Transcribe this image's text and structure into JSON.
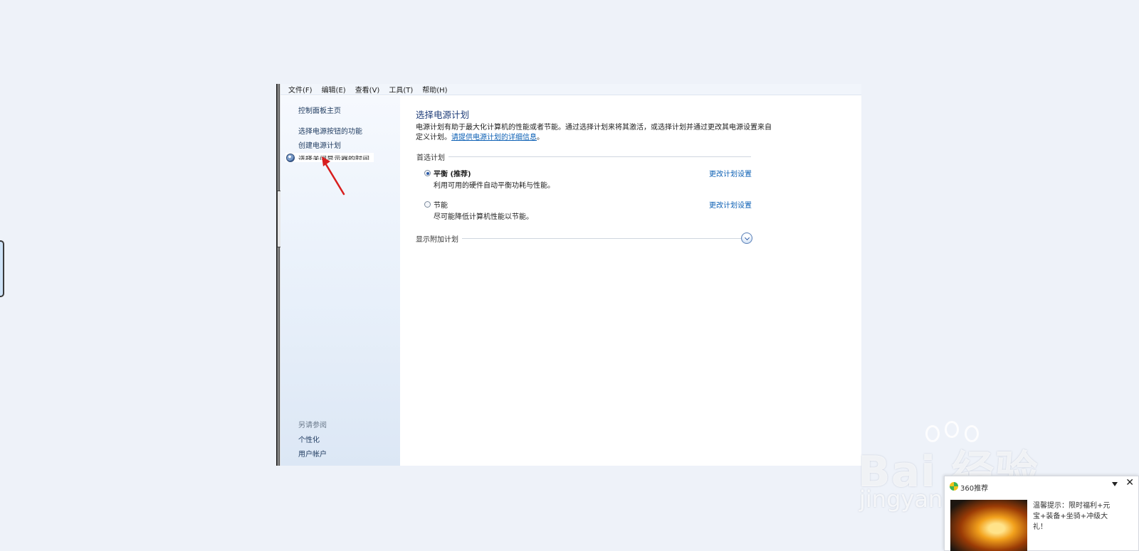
{
  "menubar": {
    "items": [
      "文件(F)",
      "编辑(E)",
      "查看(V)",
      "工具(T)",
      "帮助(H)"
    ]
  },
  "sidebar": {
    "home": "控制面板主页",
    "links": [
      "选择电源按钮的功能",
      "创建电源计划"
    ],
    "hovered_item": "选择关闭显示器的时间",
    "see_also_title": "另请参阅",
    "see_also": [
      "个性化",
      "用户帐户"
    ]
  },
  "main": {
    "title": "选择电源计划",
    "description": "电源计划有助于最大化计算机的性能或者节能。通过选择计划来将其激活，或选择计划并通过更改其电源设置来自定义计划。",
    "description_link": "请提供电源计划的详细信息",
    "description_end": "。",
    "group_label": "首选计划",
    "plans": [
      {
        "name": "平衡 (推荐)",
        "description": "利用可用的硬件自动平衡功耗与性能。",
        "link": "更改计划设置",
        "selected": true
      },
      {
        "name": "节能",
        "description": "尽可能降低计算机性能以节能。",
        "link": "更改计划设置",
        "selected": false
      }
    ],
    "extra_label": "显示附加计划"
  },
  "watermark": {
    "brand": "Bai  经验",
    "sub": "jingyan.baidu.com"
  },
  "popup": {
    "title": "360推荐",
    "text": "温馨提示：限时福利+元宝+装备+坐骑+冲级大礼！"
  }
}
